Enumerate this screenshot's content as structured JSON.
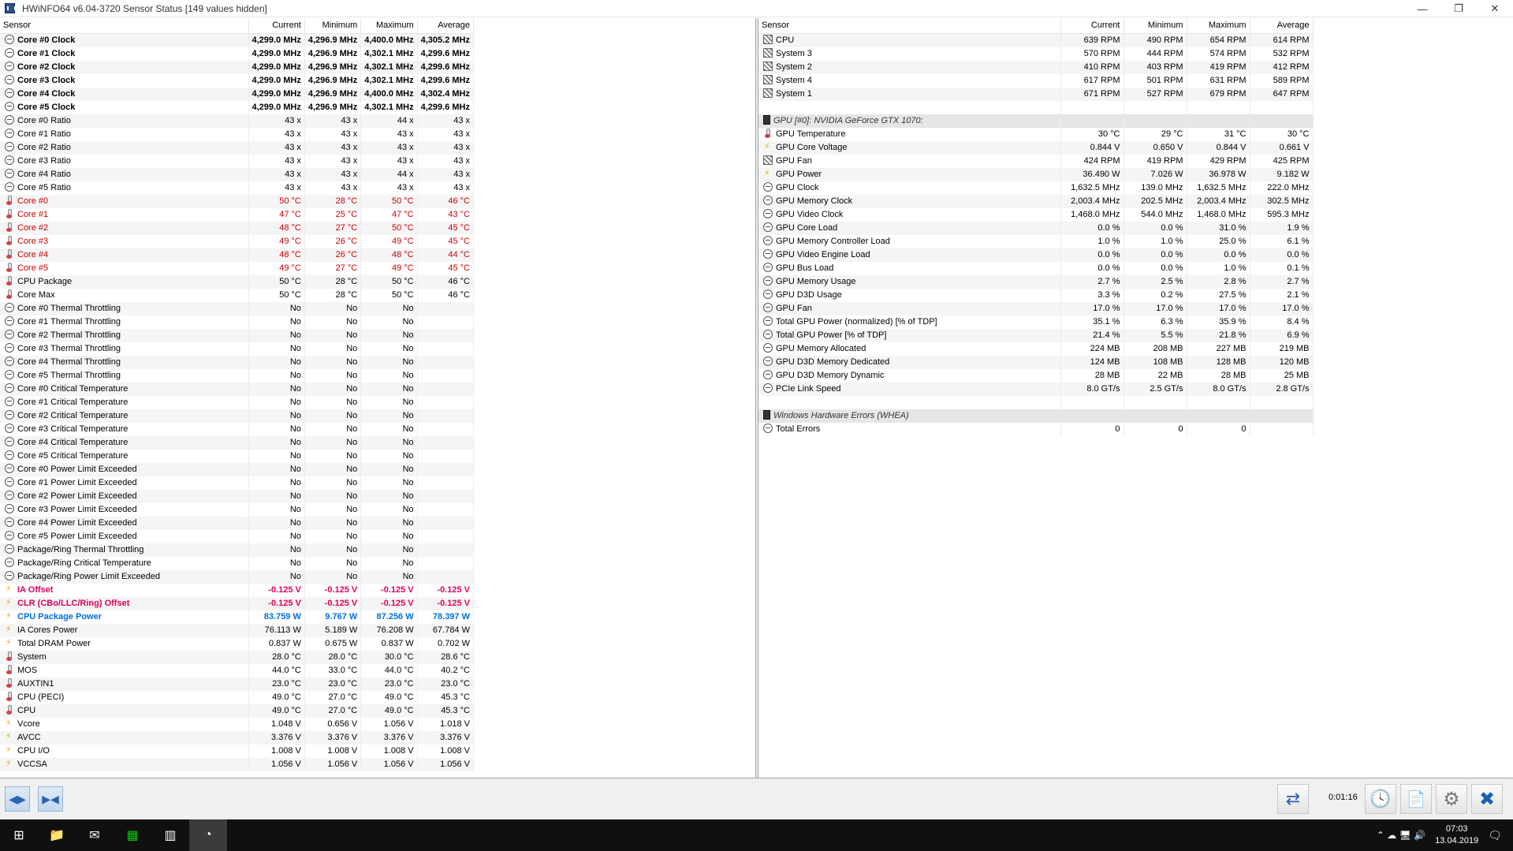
{
  "window": {
    "title": "HWiNFO64 v6.04-3720 Sensor Status [149 values hidden]",
    "min_glyph": "—",
    "max_glyph": "❐",
    "close_glyph": "✕"
  },
  "columns": {
    "sensor": "Sensor",
    "current": "Current",
    "minimum": "Minimum",
    "maximum": "Maximum",
    "average": "Average"
  },
  "left_rows": [
    {
      "icon": "clock",
      "style": "bold",
      "name": "Core #0 Clock",
      "cur": "4,299.0 MHz",
      "min": "4,296.9 MHz",
      "max": "4,400.0 MHz",
      "avg": "4,305.2 MHz"
    },
    {
      "icon": "clock",
      "style": "bold",
      "name": "Core #1 Clock",
      "cur": "4,299.0 MHz",
      "min": "4,296.9 MHz",
      "max": "4,302.1 MHz",
      "avg": "4,299.6 MHz"
    },
    {
      "icon": "clock",
      "style": "bold",
      "name": "Core #2 Clock",
      "cur": "4,299.0 MHz",
      "min": "4,296.9 MHz",
      "max": "4,302.1 MHz",
      "avg": "4,299.6 MHz"
    },
    {
      "icon": "clock",
      "style": "bold",
      "name": "Core #3 Clock",
      "cur": "4,299.0 MHz",
      "min": "4,296.9 MHz",
      "max": "4,302.1 MHz",
      "avg": "4,299.6 MHz"
    },
    {
      "icon": "clock",
      "style": "bold",
      "name": "Core #4 Clock",
      "cur": "4,299.0 MHz",
      "min": "4,296.9 MHz",
      "max": "4,400.0 MHz",
      "avg": "4,302.4 MHz"
    },
    {
      "icon": "clock",
      "style": "bold",
      "name": "Core #5 Clock",
      "cur": "4,299.0 MHz",
      "min": "4,296.9 MHz",
      "max": "4,302.1 MHz",
      "avg": "4,299.6 MHz"
    },
    {
      "icon": "clock",
      "style": "",
      "name": "Core #0 Ratio",
      "cur": "43 x",
      "min": "43 x",
      "max": "44 x",
      "avg": "43 x"
    },
    {
      "icon": "clock",
      "style": "",
      "name": "Core #1 Ratio",
      "cur": "43 x",
      "min": "43 x",
      "max": "43 x",
      "avg": "43 x"
    },
    {
      "icon": "clock",
      "style": "",
      "name": "Core #2 Ratio",
      "cur": "43 x",
      "min": "43 x",
      "max": "43 x",
      "avg": "43 x"
    },
    {
      "icon": "clock",
      "style": "",
      "name": "Core #3 Ratio",
      "cur": "43 x",
      "min": "43 x",
      "max": "43 x",
      "avg": "43 x"
    },
    {
      "icon": "clock",
      "style": "",
      "name": "Core #4 Ratio",
      "cur": "43 x",
      "min": "43 x",
      "max": "44 x",
      "avg": "43 x"
    },
    {
      "icon": "clock",
      "style": "",
      "name": "Core #5 Ratio",
      "cur": "43 x",
      "min": "43 x",
      "max": "43 x",
      "avg": "43 x"
    },
    {
      "icon": "therm",
      "style": "red",
      "name": "Core #0",
      "cur": "50 °C",
      "min": "28 °C",
      "max": "50 °C",
      "avg": "46 °C"
    },
    {
      "icon": "therm",
      "style": "red",
      "name": "Core #1",
      "cur": "47 °C",
      "min": "25 °C",
      "max": "47 °C",
      "avg": "43 °C"
    },
    {
      "icon": "therm",
      "style": "red",
      "name": "Core #2",
      "cur": "48 °C",
      "min": "27 °C",
      "max": "50 °C",
      "avg": "45 °C"
    },
    {
      "icon": "therm",
      "style": "red",
      "name": "Core #3",
      "cur": "49 °C",
      "min": "26 °C",
      "max": "49 °C",
      "avg": "45 °C"
    },
    {
      "icon": "therm",
      "style": "red",
      "name": "Core #4",
      "cur": "48 °C",
      "min": "26 °C",
      "max": "48 °C",
      "avg": "44 °C"
    },
    {
      "icon": "therm",
      "style": "red",
      "name": "Core #5",
      "cur": "49 °C",
      "min": "27 °C",
      "max": "49 °C",
      "avg": "45 °C"
    },
    {
      "icon": "therm",
      "style": "",
      "name": "CPU Package",
      "cur": "50 °C",
      "min": "28 °C",
      "max": "50 °C",
      "avg": "46 °C"
    },
    {
      "icon": "therm",
      "style": "",
      "name": "Core Max",
      "cur": "50 °C",
      "min": "28 °C",
      "max": "50 °C",
      "avg": "46 °C"
    },
    {
      "icon": "clock",
      "style": "",
      "name": "Core #0 Thermal Throttling",
      "cur": "No",
      "min": "No",
      "max": "No",
      "avg": ""
    },
    {
      "icon": "clock",
      "style": "",
      "name": "Core #1 Thermal Throttling",
      "cur": "No",
      "min": "No",
      "max": "No",
      "avg": ""
    },
    {
      "icon": "clock",
      "style": "",
      "name": "Core #2 Thermal Throttling",
      "cur": "No",
      "min": "No",
      "max": "No",
      "avg": ""
    },
    {
      "icon": "clock",
      "style": "",
      "name": "Core #3 Thermal Throttling",
      "cur": "No",
      "min": "No",
      "max": "No",
      "avg": ""
    },
    {
      "icon": "clock",
      "style": "",
      "name": "Core #4 Thermal Throttling",
      "cur": "No",
      "min": "No",
      "max": "No",
      "avg": ""
    },
    {
      "icon": "clock",
      "style": "",
      "name": "Core #5 Thermal Throttling",
      "cur": "No",
      "min": "No",
      "max": "No",
      "avg": ""
    },
    {
      "icon": "clock",
      "style": "",
      "name": "Core #0 Critical Temperature",
      "cur": "No",
      "min": "No",
      "max": "No",
      "avg": ""
    },
    {
      "icon": "clock",
      "style": "",
      "name": "Core #1 Critical Temperature",
      "cur": "No",
      "min": "No",
      "max": "No",
      "avg": ""
    },
    {
      "icon": "clock",
      "style": "",
      "name": "Core #2 Critical Temperature",
      "cur": "No",
      "min": "No",
      "max": "No",
      "avg": ""
    },
    {
      "icon": "clock",
      "style": "",
      "name": "Core #3 Critical Temperature",
      "cur": "No",
      "min": "No",
      "max": "No",
      "avg": ""
    },
    {
      "icon": "clock",
      "style": "",
      "name": "Core #4 Critical Temperature",
      "cur": "No",
      "min": "No",
      "max": "No",
      "avg": ""
    },
    {
      "icon": "clock",
      "style": "",
      "name": "Core #5 Critical Temperature",
      "cur": "No",
      "min": "No",
      "max": "No",
      "avg": ""
    },
    {
      "icon": "clock",
      "style": "",
      "name": "Core #0 Power Limit Exceeded",
      "cur": "No",
      "min": "No",
      "max": "No",
      "avg": ""
    },
    {
      "icon": "clock",
      "style": "",
      "name": "Core #1 Power Limit Exceeded",
      "cur": "No",
      "min": "No",
      "max": "No",
      "avg": ""
    },
    {
      "icon": "clock",
      "style": "",
      "name": "Core #2 Power Limit Exceeded",
      "cur": "No",
      "min": "No",
      "max": "No",
      "avg": ""
    },
    {
      "icon": "clock",
      "style": "",
      "name": "Core #3 Power Limit Exceeded",
      "cur": "No",
      "min": "No",
      "max": "No",
      "avg": ""
    },
    {
      "icon": "clock",
      "style": "",
      "name": "Core #4 Power Limit Exceeded",
      "cur": "No",
      "min": "No",
      "max": "No",
      "avg": ""
    },
    {
      "icon": "clock",
      "style": "",
      "name": "Core #5 Power Limit Exceeded",
      "cur": "No",
      "min": "No",
      "max": "No",
      "avg": ""
    },
    {
      "icon": "clock",
      "style": "",
      "name": "Package/Ring Thermal Throttling",
      "cur": "No",
      "min": "No",
      "max": "No",
      "avg": ""
    },
    {
      "icon": "clock",
      "style": "",
      "name": "Package/Ring Critical Temperature",
      "cur": "No",
      "min": "No",
      "max": "No",
      "avg": ""
    },
    {
      "icon": "clock",
      "style": "",
      "name": "Package/Ring Power Limit Exceeded",
      "cur": "No",
      "min": "No",
      "max": "No",
      "avg": ""
    },
    {
      "icon": "volt",
      "style": "magenta",
      "name": "IA Offset",
      "cur": "-0.125 V",
      "min": "-0.125 V",
      "max": "-0.125 V",
      "avg": "-0.125 V"
    },
    {
      "icon": "volt",
      "style": "magenta",
      "name": "CLR (CBo/LLC/Ring) Offset",
      "cur": "-0.125 V",
      "min": "-0.125 V",
      "max": "-0.125 V",
      "avg": "-0.125 V"
    },
    {
      "icon": "volt",
      "style": "blue",
      "name": "CPU Package Power",
      "cur": "83.759 W",
      "min": "9.767 W",
      "max": "87.256 W",
      "avg": "78.397 W"
    },
    {
      "icon": "volt",
      "style": "",
      "name": "IA Cores Power",
      "cur": "76.113 W",
      "min": "5.189 W",
      "max": "76.208 W",
      "avg": "67.784 W"
    },
    {
      "icon": "volt",
      "style": "",
      "name": "Total DRAM Power",
      "cur": "0.837 W",
      "min": "0.675 W",
      "max": "0.837 W",
      "avg": "0.702 W"
    },
    {
      "icon": "therm",
      "style": "",
      "name": "System",
      "cur": "28.0 °C",
      "min": "28.0 °C",
      "max": "30.0 °C",
      "avg": "28.6 °C"
    },
    {
      "icon": "therm",
      "style": "",
      "name": "MOS",
      "cur": "44.0 °C",
      "min": "33.0 °C",
      "max": "44.0 °C",
      "avg": "40.2 °C"
    },
    {
      "icon": "therm",
      "style": "",
      "name": "AUXTIN1",
      "cur": "23.0 °C",
      "min": "23.0 °C",
      "max": "23.0 °C",
      "avg": "23.0 °C"
    },
    {
      "icon": "therm",
      "style": "",
      "name": "CPU (PECI)",
      "cur": "49.0 °C",
      "min": "27.0 °C",
      "max": "49.0 °C",
      "avg": "45.3 °C"
    },
    {
      "icon": "therm",
      "style": "",
      "name": "CPU",
      "cur": "49.0 °C",
      "min": "27.0 °C",
      "max": "49.0 °C",
      "avg": "45.3 °C"
    },
    {
      "icon": "volt",
      "style": "",
      "name": "Vcore",
      "cur": "1.048 V",
      "min": "0.656 V",
      "max": "1.056 V",
      "avg": "1.018 V"
    },
    {
      "icon": "volt",
      "style": "",
      "name": "AVCC",
      "cur": "3.376 V",
      "min": "3.376 V",
      "max": "3.376 V",
      "avg": "3.376 V"
    },
    {
      "icon": "volt",
      "style": "",
      "name": "CPU I/O",
      "cur": "1.008 V",
      "min": "1.008 V",
      "max": "1.008 V",
      "avg": "1.008 V"
    },
    {
      "icon": "volt",
      "style": "",
      "name": "VCCSA",
      "cur": "1.056 V",
      "min": "1.056 V",
      "max": "1.056 V",
      "avg": "1.056 V"
    }
  ],
  "right_rows": [
    {
      "icon": "fan",
      "style": "",
      "name": "CPU",
      "cur": "639 RPM",
      "min": "490 RPM",
      "max": "654 RPM",
      "avg": "614 RPM"
    },
    {
      "icon": "fan",
      "style": "",
      "name": "System 3",
      "cur": "570 RPM",
      "min": "444 RPM",
      "max": "574 RPM",
      "avg": "532 RPM"
    },
    {
      "icon": "fan",
      "style": "",
      "name": "System 2",
      "cur": "410 RPM",
      "min": "403 RPM",
      "max": "419 RPM",
      "avg": "412 RPM"
    },
    {
      "icon": "fan",
      "style": "",
      "name": "System 4",
      "cur": "617 RPM",
      "min": "501 RPM",
      "max": "631 RPM",
      "avg": "589 RPM"
    },
    {
      "icon": "fan",
      "style": "",
      "name": "System 1",
      "cur": "671 RPM",
      "min": "527 RPM",
      "max": "679 RPM",
      "avg": "647 RPM"
    },
    {
      "icon": "",
      "style": "blank",
      "name": "",
      "cur": "",
      "min": "",
      "max": "",
      "avg": ""
    },
    {
      "icon": "dev",
      "style": "group",
      "name": "GPU [#0]: NVIDIA GeForce GTX 1070:",
      "cur": "",
      "min": "",
      "max": "",
      "avg": ""
    },
    {
      "icon": "therm",
      "style": "",
      "name": "GPU Temperature",
      "cur": "30 °C",
      "min": "29 °C",
      "max": "31 °C",
      "avg": "30 °C"
    },
    {
      "icon": "volt",
      "style": "",
      "name": "GPU Core Voltage",
      "cur": "0.844 V",
      "min": "0.650 V",
      "max": "0.844 V",
      "avg": "0.661 V"
    },
    {
      "icon": "fan",
      "style": "",
      "name": "GPU Fan",
      "cur": "424 RPM",
      "min": "419 RPM",
      "max": "429 RPM",
      "avg": "425 RPM"
    },
    {
      "icon": "volt",
      "style": "",
      "name": "GPU Power",
      "cur": "36.490 W",
      "min": "7.026 W",
      "max": "36.978 W",
      "avg": "9.182 W"
    },
    {
      "icon": "clock",
      "style": "",
      "name": "GPU Clock",
      "cur": "1,632.5 MHz",
      "min": "139.0 MHz",
      "max": "1,632.5 MHz",
      "avg": "222.0 MHz"
    },
    {
      "icon": "clock",
      "style": "",
      "name": "GPU Memory Clock",
      "cur": "2,003.4 MHz",
      "min": "202.5 MHz",
      "max": "2,003.4 MHz",
      "avg": "302.5 MHz"
    },
    {
      "icon": "clock",
      "style": "",
      "name": "GPU Video Clock",
      "cur": "1,468.0 MHz",
      "min": "544.0 MHz",
      "max": "1,468.0 MHz",
      "avg": "595.3 MHz"
    },
    {
      "icon": "clock",
      "style": "",
      "name": "GPU Core Load",
      "cur": "0.0 %",
      "min": "0.0 %",
      "max": "31.0 %",
      "avg": "1.9 %"
    },
    {
      "icon": "clock",
      "style": "",
      "name": "GPU Memory Controller Load",
      "cur": "1.0 %",
      "min": "1.0 %",
      "max": "25.0 %",
      "avg": "6.1 %"
    },
    {
      "icon": "clock",
      "style": "",
      "name": "GPU Video Engine Load",
      "cur": "0.0 %",
      "min": "0.0 %",
      "max": "0.0 %",
      "avg": "0.0 %"
    },
    {
      "icon": "clock",
      "style": "",
      "name": "GPU Bus Load",
      "cur": "0.0 %",
      "min": "0.0 %",
      "max": "1.0 %",
      "avg": "0.1 %"
    },
    {
      "icon": "clock",
      "style": "",
      "name": "GPU Memory Usage",
      "cur": "2.7 %",
      "min": "2.5 %",
      "max": "2.8 %",
      "avg": "2.7 %"
    },
    {
      "icon": "clock",
      "style": "",
      "name": "GPU D3D Usage",
      "cur": "3.3 %",
      "min": "0.2 %",
      "max": "27.5 %",
      "avg": "2.1 %"
    },
    {
      "icon": "clock",
      "style": "",
      "name": "GPU Fan",
      "cur": "17.0 %",
      "min": "17.0 %",
      "max": "17.0 %",
      "avg": "17.0 %"
    },
    {
      "icon": "clock",
      "style": "",
      "name": "Total GPU Power (normalized) [% of TDP]",
      "cur": "35.1 %",
      "min": "6.3 %",
      "max": "35.9 %",
      "avg": "8.4 %"
    },
    {
      "icon": "clock",
      "style": "",
      "name": "Total GPU Power [% of TDP]",
      "cur": "21.4 %",
      "min": "5.5 %",
      "max": "21.8 %",
      "avg": "6.9 %"
    },
    {
      "icon": "clock",
      "style": "",
      "name": "GPU Memory Allocated",
      "cur": "224 MB",
      "min": "208 MB",
      "max": "227 MB",
      "avg": "219 MB"
    },
    {
      "icon": "clock",
      "style": "",
      "name": "GPU D3D Memory Dedicated",
      "cur": "124 MB",
      "min": "108 MB",
      "max": "128 MB",
      "avg": "120 MB"
    },
    {
      "icon": "clock",
      "style": "",
      "name": "GPU D3D Memory Dynamic",
      "cur": "28 MB",
      "min": "22 MB",
      "max": "28 MB",
      "avg": "25 MB"
    },
    {
      "icon": "clock",
      "style": "",
      "name": "PCIe Link Speed",
      "cur": "8.0 GT/s",
      "min": "2.5 GT/s",
      "max": "8.0 GT/s",
      "avg": "2.8 GT/s"
    },
    {
      "icon": "",
      "style": "blank",
      "name": "",
      "cur": "",
      "min": "",
      "max": "",
      "avg": ""
    },
    {
      "icon": "dev",
      "style": "group",
      "name": "Windows Hardware Errors (WHEA)",
      "cur": "",
      "min": "",
      "max": "",
      "avg": ""
    },
    {
      "icon": "clock",
      "style": "",
      "name": "Total Errors",
      "cur": "0",
      "min": "0",
      "max": "0",
      "avg": ""
    }
  ],
  "toolbar": {
    "nav_left_glyph": "◀▶",
    "nav_right_glyph": "▶◀",
    "elapsed": "0:01:16",
    "refresh_icon": "⇄",
    "clock_icon": "🕓",
    "report_icon": "📄",
    "settings_icon": "⚙",
    "close_icon": "✖"
  },
  "taskbar": {
    "start_glyph": "⊞",
    "apps": [
      {
        "name": "explorer",
        "glyph": "📁"
      },
      {
        "name": "mail",
        "glyph": "✉"
      },
      {
        "name": "app-green",
        "glyph": "▦"
      },
      {
        "name": "app-calendar",
        "glyph": "▥"
      },
      {
        "name": "hwinfo",
        "glyph": "◔"
      }
    ],
    "tray_glyphs": "⌃  ☁  🖥  🔊",
    "time": "07:03",
    "date": "13.04.2019",
    "notify_glyph": "🗨"
  },
  "colors": {
    "red": "#d00000",
    "magenta": "#e00060",
    "blue": "#0070e0",
    "group_bg": "#e6e6e6"
  }
}
